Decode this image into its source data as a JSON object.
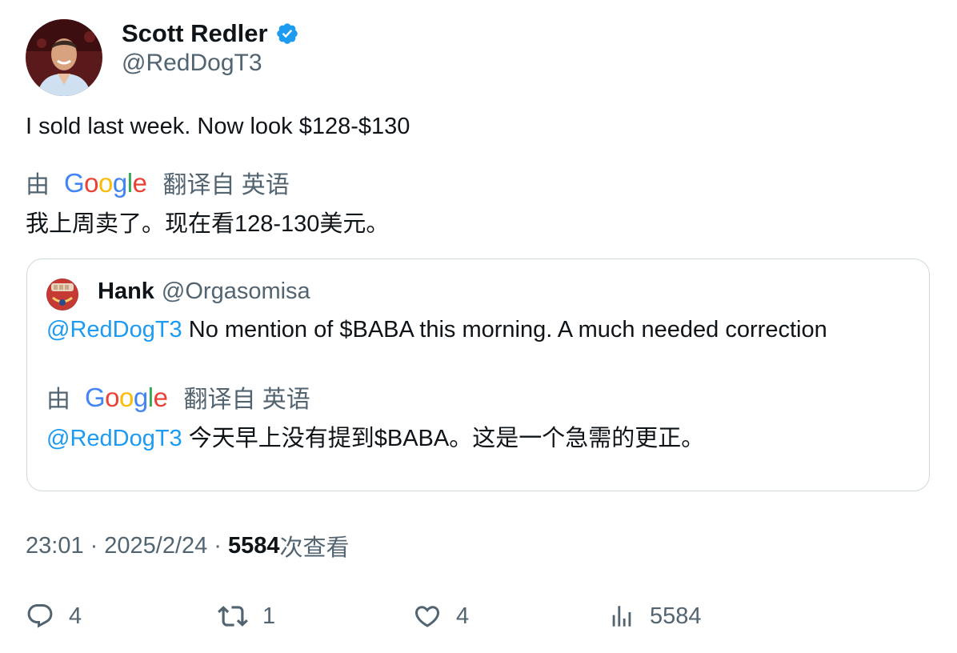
{
  "author": {
    "name": "Scott Redler",
    "handle": "@RedDogT3",
    "verified": true,
    "verified_color": "#1d9bf0"
  },
  "tweet": {
    "text": "I sold last week. Now look $128-$130",
    "translation": {
      "by_label": "由",
      "provider": "Google",
      "from_label": "翻译自 英语",
      "text": "我上周卖了。现在看128-130美元。"
    }
  },
  "quote": {
    "name": "Hank",
    "handle": "@Orgasomisa",
    "mention": "@RedDogT3",
    "text": " No mention of $BABA this morning. A much needed correction",
    "translation": {
      "by_label": "由",
      "provider": "Google",
      "from_label": "翻译自 英语",
      "mention": "@RedDogT3",
      "text": " 今天早上没有提到$BABA。这是一个急需的更正。"
    }
  },
  "meta": {
    "time": "23:01",
    "date": "2025/2/24",
    "views_count": "5584",
    "views_label": "次查看"
  },
  "actions": {
    "reply_count": "4",
    "retweet_count": "1",
    "like_count": "4",
    "views_count": "5584"
  },
  "colors": {
    "text": "#0f1419",
    "secondary": "#536471",
    "link": "#1d9bf0",
    "border": "#cfd9de"
  }
}
